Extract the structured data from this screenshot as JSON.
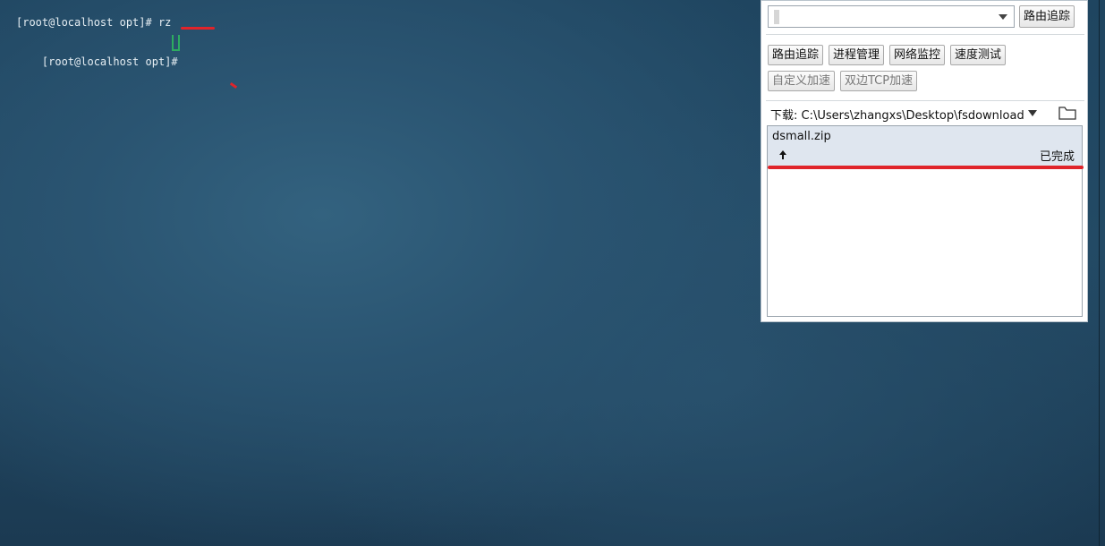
{
  "terminal": {
    "lines": [
      "[root@localhost opt]# rz",
      "[root@localhost opt]# "
    ]
  },
  "panel": {
    "combo_value": "",
    "route_trace_top": "路由追踪",
    "tools": {
      "route_trace": "路由追踪",
      "process_mgmt": "进程管理",
      "network_monitor": "网络监控",
      "speed_test": "速度测试",
      "custom_accel": "自定义加速",
      "tcp_accel": "双边TCP加速"
    },
    "download": {
      "label": "下载: C:\\Users\\zhangxs\\Desktop\\fsdownload"
    },
    "transfers": [
      {
        "name": "dsmall.zip",
        "status": "已完成",
        "direction_icon": "upload-arrow-icon"
      }
    ]
  },
  "colors": {
    "highlight_red": "#e0242a",
    "cursor_green": "#2dab60",
    "item_bg": "#dfe6ef"
  }
}
